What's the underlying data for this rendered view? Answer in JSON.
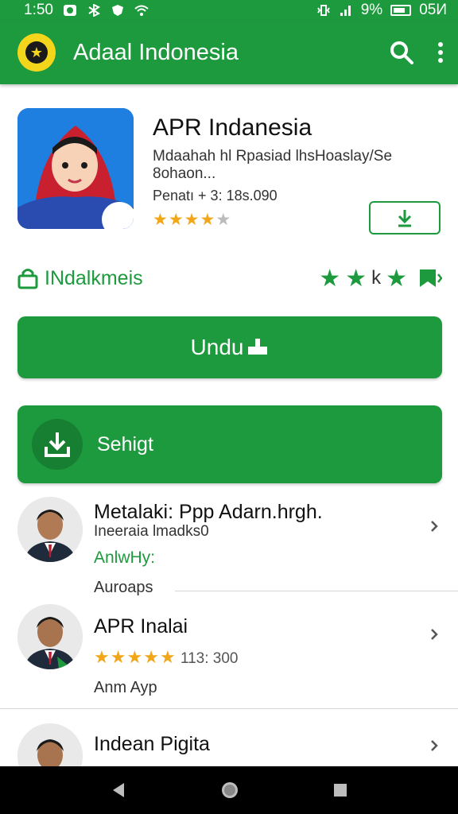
{
  "status_bar": {
    "time": "1:50",
    "battery_pct": "9%",
    "clock_right": "05И"
  },
  "app_bar": {
    "title": "Adaal Indonesia"
  },
  "app": {
    "name": "APR Indanesia",
    "description": "Mdaahah hl Rpasiad lhsHoaslay/Se 8ohaon...",
    "count": "Penatı +  3: 18s.090",
    "rating": 3.5
  },
  "meta": {
    "label": "INdalkmeis"
  },
  "install_button": {
    "label": "Undu"
  },
  "secondary_button": {
    "label": "Sehigt"
  },
  "list": [
    {
      "title": "Metalaki: Ppp Adarn.hrgh.",
      "subtitle": "Ineeraia lmadks0",
      "green_text": "AnlwHy:",
      "footer": "Auroaps"
    },
    {
      "title": "APR Inalai",
      "rating": 4.5,
      "rating_text": "113: 300",
      "footer": "Anm Ayp"
    },
    {
      "title": "Indean Pigita"
    }
  ],
  "colors": {
    "accent": "#1e9a3e",
    "star": "#f2a71a",
    "logo": "#f3d61c"
  }
}
